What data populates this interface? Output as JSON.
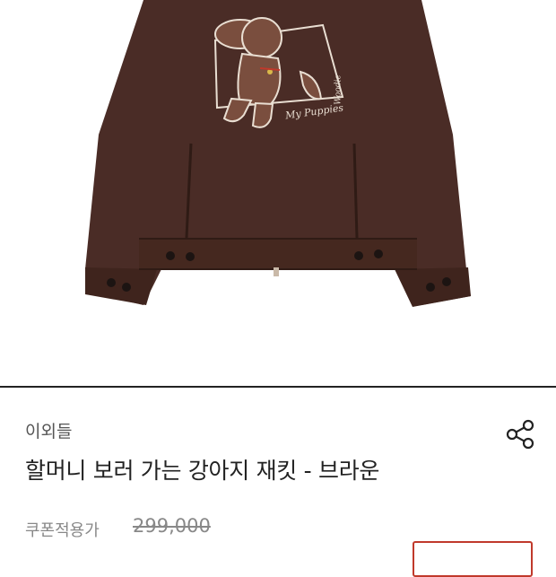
{
  "product": {
    "brand": "이외들",
    "title": "할머니 보러 가는 강아지 재킷 - 브라운",
    "price_label": "쿠폰적용가",
    "original_price": "299,000",
    "image": {
      "patch_script": "My Puppies",
      "vertical_script": "Woodie",
      "jacket_color": "#4a2c26",
      "patch_color": "#7a4e3e"
    }
  },
  "icons": {
    "share": "share-icon"
  },
  "colors": {
    "accent": "#c0392b",
    "divider": "#222222"
  }
}
